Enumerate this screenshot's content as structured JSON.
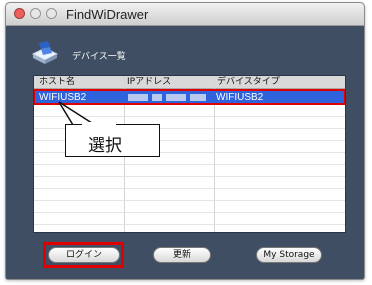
{
  "window": {
    "title": "FindWiDrawer"
  },
  "header": {
    "label": "デバイス一覧"
  },
  "table": {
    "columns": [
      "ホスト名",
      "IPアドレス",
      "デバイスタイプ"
    ],
    "rows": [
      {
        "host": "WIFIUSB2",
        "ip": "",
        "type": "WIFIUSB2",
        "selected": true
      }
    ]
  },
  "callout": {
    "text": "選択"
  },
  "buttons": {
    "login": "ログイン",
    "refresh": "更新",
    "storage": "My Storage"
  },
  "colors": {
    "selection": "#2f63de",
    "highlight": "#e00000",
    "window_bg": "#3f4e63"
  }
}
